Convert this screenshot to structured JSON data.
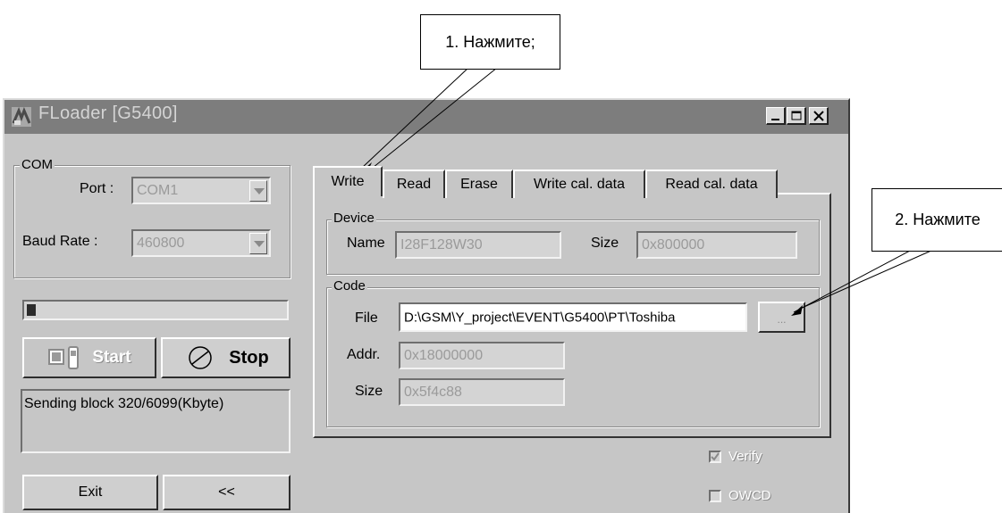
{
  "callouts": {
    "first": "1. Нажмите;",
    "second": "2. Нажмите"
  },
  "window": {
    "title": "FLoader [G5400]",
    "icon": "floader-app-icon",
    "controls": [
      "minimize-icon",
      "maximize-icon",
      "close-icon"
    ]
  },
  "com": {
    "group_label": "COM",
    "port_label": "Port :",
    "port_value": "COM1",
    "baud_label": "Baud Rate :",
    "baud_value": "460800"
  },
  "progress": {
    "fraction": 0.03
  },
  "buttons": {
    "start": "Start",
    "stop": "Stop",
    "exit": "Exit",
    "collapse": "<<",
    "browse": "..."
  },
  "status": {
    "message": "Sending block 320/6099(Kbyte)"
  },
  "tabs": [
    "Write",
    "Read",
    "Erase",
    "Write cal. data",
    "Read cal. data"
  ],
  "device": {
    "group_label": "Device",
    "name_label": "Name",
    "name_value": "I28F128W30",
    "size_label": "Size",
    "size_value": "0x800000"
  },
  "code": {
    "group_label": "Code",
    "file_label": "File",
    "file_value": "D:\\GSM\\Y_project\\EVENT\\G5400\\PT\\Toshiba",
    "addr_label": "Addr.",
    "addr_value": "0x18000000",
    "size_label": "Size",
    "size_value": "0x5f4c88"
  },
  "options": {
    "verify_label": "Verify",
    "verify_checked": true,
    "owcd_label": "OWCD",
    "owcd_checked": false
  }
}
